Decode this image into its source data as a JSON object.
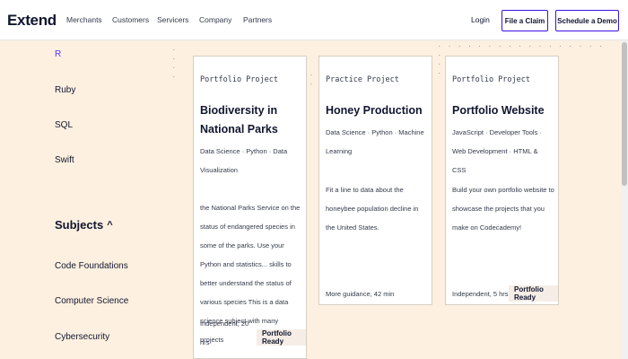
{
  "header": {
    "brand": "Extend",
    "nav": [
      "Merchants",
      "Customers",
      "Servicers",
      "Company",
      "Partners"
    ],
    "login": "Login",
    "file_claim": "File a Claim",
    "schedule_demo": "Schedule a Demo"
  },
  "sidebar": {
    "languages": [
      "R",
      "Ruby",
      "SQL",
      "Swift"
    ],
    "subjects_heading": "Subjects",
    "subjects": [
      "Code Foundations",
      "Computer Science",
      "Cybersecurity"
    ]
  },
  "cards": [
    {
      "type": "Portfolio Project",
      "title": "Biodiversity in National Parks",
      "tags": "Data Science · Python · Data Visualization",
      "description": "the National Parks Service on the status of endangered species in some of the parks. Use your Python and statistics... skills to better understand the status of various species This is a data science subject with many projects",
      "meta": "Independent, 20 hrs",
      "badge": "Portfolio Ready"
    },
    {
      "type": "Practice Project",
      "title": "Honey Production",
      "tags": "Data Science · Python · Machine Learning",
      "description": "Fit a line to data about the honeybee population decline in the United States.",
      "meta": "More guidance, 42 min",
      "badge": ""
    },
    {
      "type": "Portfolio Project",
      "title": "Portfolio Website",
      "tags": "JavaScript · Developer Tools · Web Development · HTML & CSS",
      "description": "Build your own portfolio website to showcase the projects that you make on Codecademy!",
      "meta": "Independent, 5 hrs",
      "badge": "Portfolio Ready"
    }
  ],
  "colors": {
    "background": "#fdf0e0",
    "accent": "#3a10e5",
    "active_link": "#5533ff",
    "badge_bg": "#f5ede6"
  }
}
